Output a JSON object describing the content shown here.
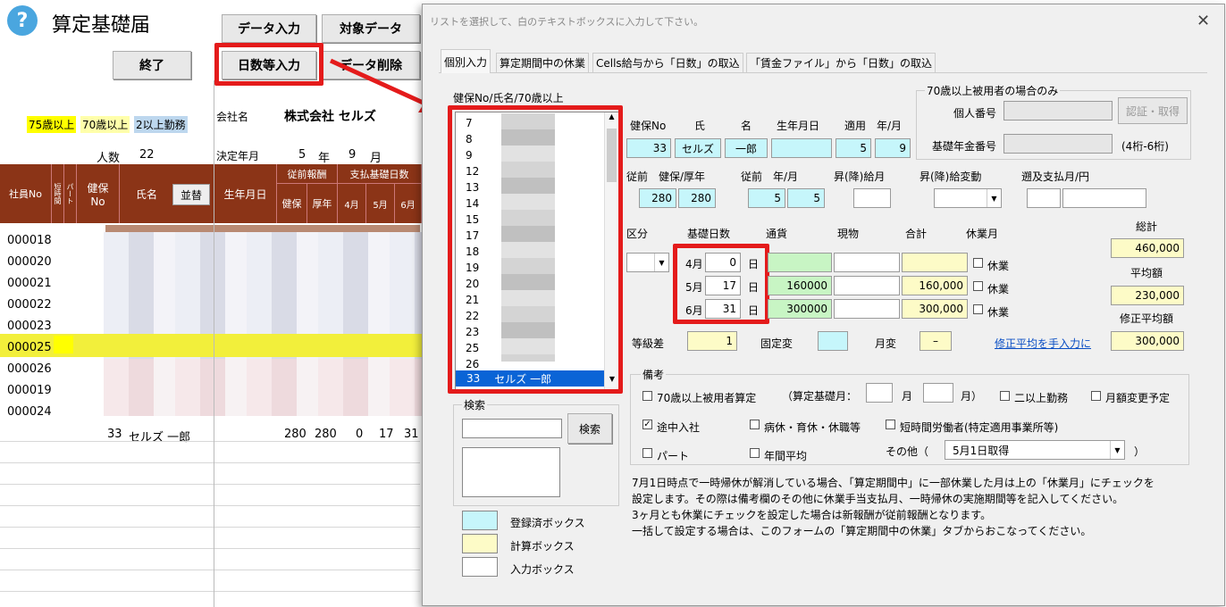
{
  "sheet": {
    "title": "算定基礎届",
    "buttons": {
      "end": "終了",
      "data_input": "データ入力",
      "target_data": "対象データ",
      "days_input": "日数等入力",
      "data_delete": "データ削除"
    },
    "legend": [
      {
        "label": "75歳以上",
        "color": "#ffff00"
      },
      {
        "label": "70歳以上",
        "color": "#ffffaa"
      },
      {
        "label": "2以上勤務",
        "color": "#bdd7ee"
      }
    ],
    "company_label": "会社名",
    "company_name": "株式会社 セルズ",
    "count_label": "人数",
    "count_value": "22",
    "decision_label": "決定年月",
    "decision_year": "5",
    "year_unit": "年",
    "decision_month": "9",
    "month_unit": "月",
    "headers": {
      "emp_no": "社員No",
      "col2": "短時間",
      "col3": "パート",
      "kenpo_no": "健保\nNo",
      "name": "氏名",
      "sort_button": "並替",
      "birthdate": "生年月日",
      "prev_salary": "従前報酬",
      "kenpo": "健保",
      "kosei": "厚年",
      "payment_days": "支払基礎日数",
      "m4": "4月",
      "m5": "5月",
      "m6": "6月"
    },
    "employees": [
      "000018",
      "000020",
      "000021",
      "000022",
      "000023",
      "000025",
      "000026",
      "000019",
      "000024"
    ],
    "summary": {
      "no": "33",
      "name": "セルズ 一郎",
      "kenpo": "280",
      "kosei": "280",
      "d4": "0",
      "d5": "17",
      "d6": "31"
    }
  },
  "dialog": {
    "title": "リストを選択して、白のテキストボックスに入力して下さい。",
    "close_icon": "close-icon",
    "tabs": [
      "個別入力",
      "算定期間中の休業",
      "Cells給与から「日数」の取込",
      "「賃金ファイル」から「日数」の取込"
    ],
    "list_label": "健保No/氏名/70歳以上",
    "list_items": [
      "7",
      "8",
      "9",
      "12",
      "13",
      "14",
      "15",
      "17",
      "18",
      "19",
      "20",
      "21",
      "22",
      "23",
      "25",
      "26"
    ],
    "list_selected": {
      "no": "33",
      "name": "セルズ 一郎"
    },
    "search_group": "検索",
    "search_button": "検索",
    "legend_boxes": [
      {
        "label": "登録済ボックス",
        "color": "#c6f6fb"
      },
      {
        "label": "計算ボックス",
        "color": "#fdfbc7"
      },
      {
        "label": "入力ボックス",
        "color": "#ffffff"
      }
    ],
    "headers": {
      "kenpo_no": "健保No",
      "family": "氏",
      "given": "名",
      "birth": "生年月日",
      "apply": "適用",
      "ym": "年/月"
    },
    "values": {
      "kenpo_no": "33",
      "family": "セルズ",
      "given": "一郎",
      "birth": "",
      "apply_year": "5",
      "apply_month": "9"
    },
    "over70": {
      "group": "70歳以上被用者の場合のみ",
      "personal_no": "個人番号",
      "auth_button": "認証・取得",
      "pension_no": "基礎年金番号",
      "digits_hint": "(4桁-6桁)"
    },
    "prev": {
      "label1": "従前",
      "label2": "健保/厚年",
      "kenpo": "280",
      "kosei": "280",
      "label3": "従前",
      "label4": "年/月",
      "year": "5",
      "month": "5",
      "raise_salary": "昇(降)給月",
      "raise_change": "昇(降)給変動",
      "retro": "遡及支払",
      "retro_ym": "月/円"
    },
    "days": {
      "kubun": "区分",
      "header": "基礎日数",
      "cash": "通貨",
      "goods": "現物",
      "total": "合計",
      "leave": "休業月",
      "day_unit": "日",
      "rows": [
        {
          "month": "4月",
          "days": "0",
          "cash": "",
          "goods": "",
          "total": "",
          "leave": "休業"
        },
        {
          "month": "5月",
          "days": "17",
          "cash": "160000",
          "goods": "",
          "total": "160,000",
          "leave": "休業"
        },
        {
          "month": "6月",
          "days": "31",
          "cash": "300000",
          "goods": "",
          "total": "300,000",
          "leave": "休業"
        }
      ]
    },
    "sums": {
      "total_label": "総計",
      "total": "460,000",
      "avg_label": "平均額",
      "avg": "230,000",
      "mod_avg_label": "修正平均額",
      "mod_avg": "300,000"
    },
    "grade": {
      "label": "等級差",
      "value": "1",
      "fixed_label": "固定変",
      "fixed": "",
      "monthly_label": "月変",
      "monthly": "–",
      "link": "修正平均を手入力に"
    },
    "notes": {
      "group": "備考",
      "over70": "70歳以上被用者算定",
      "basis_month": "（算定基礎月：",
      "month_unit": "月",
      "month_close": "月）",
      "multi": "二以上勤務",
      "monthly_change": "月額変更予定",
      "mid_join": "途中入社",
      "sick": "病休・育休・休職等",
      "short_time": "短時間労働者(特定適用事業所等)",
      "part": "パート",
      "annual_avg": "年間平均",
      "other": "その他（",
      "other_value": "5月1日取得",
      "other_close": "）"
    },
    "footer": [
      "7月1日時点で一時帰休が解消している場合、「算定期間中」に一部休業した月は上の「休業月」にチェックを",
      "設定します。その際は備考欄のその他に休業手当支払月、一時帰休の実施期間等を記入してください。",
      "3ヶ月とも休業にチェックを設定した場合は新報酬が従前報酬となります。",
      "一括して設定する場合は、このフォームの「算定期間中の休業」タブからおこなってください。"
    ]
  }
}
